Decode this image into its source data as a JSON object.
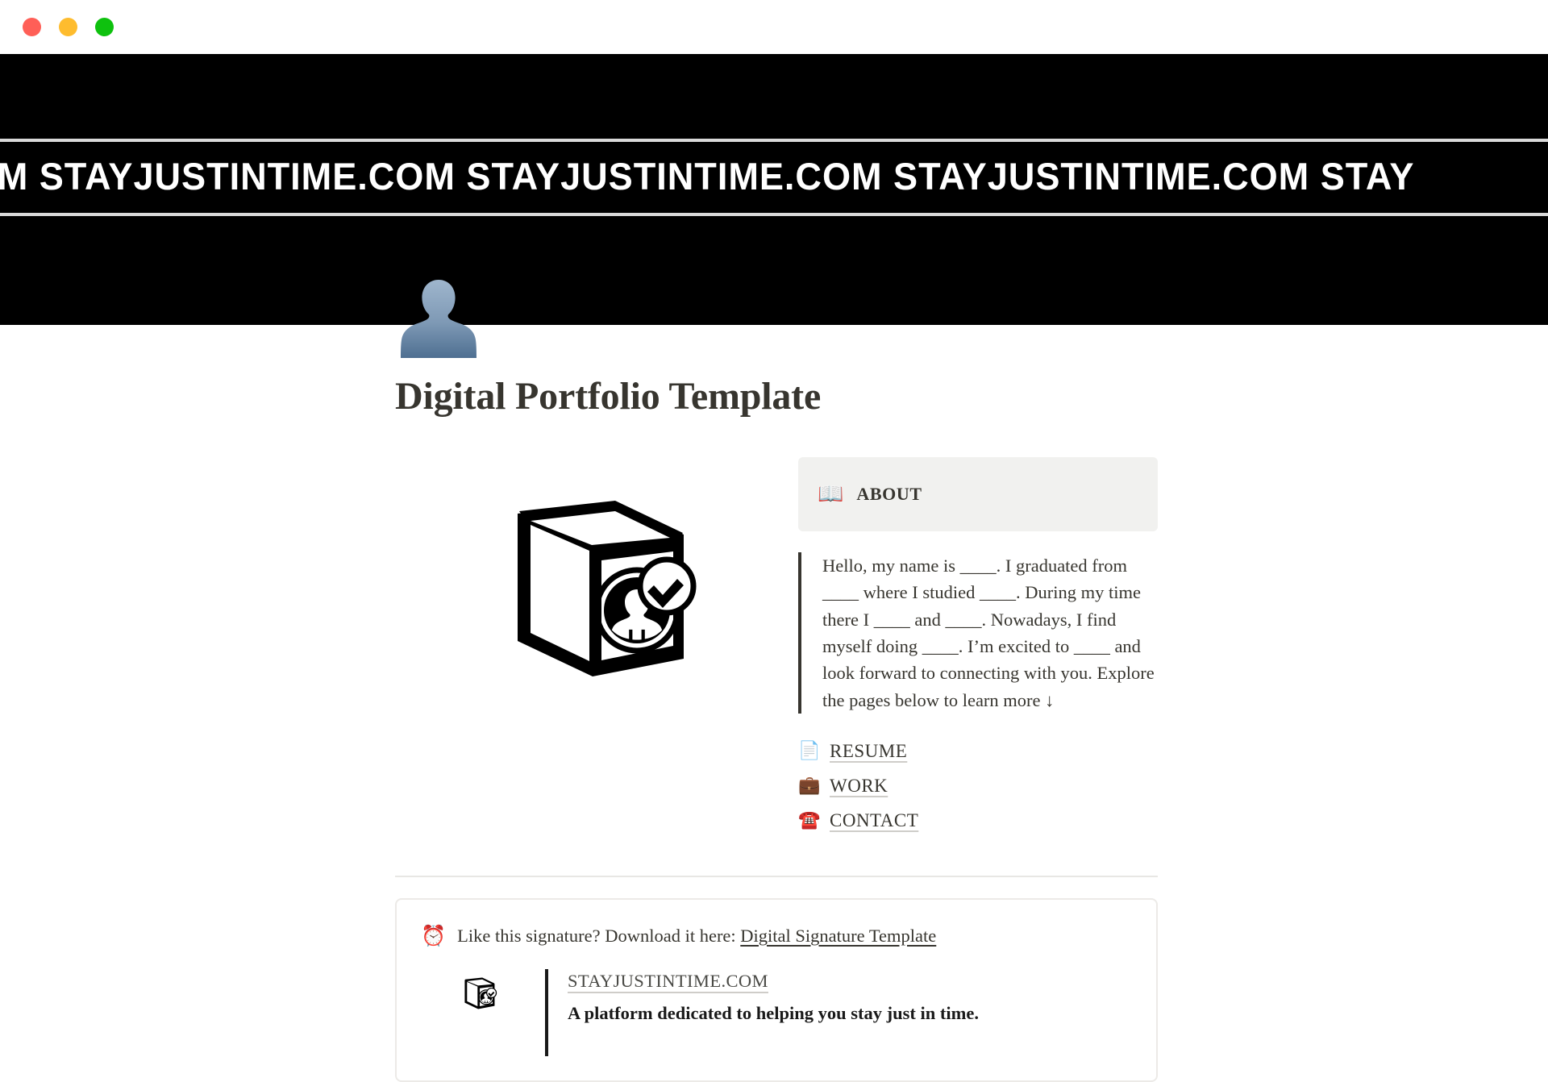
{
  "window": {
    "traffic_lights": [
      {
        "name": "close",
        "color": "#ff5f57"
      },
      {
        "name": "minimize",
        "color": "#febc2e"
      },
      {
        "name": "maximize",
        "color": "#0ec10e"
      }
    ]
  },
  "hero": {
    "marquee_text": "TIME.COM  STAYJUSTINTIME.COM  STAYJUSTINTIME.COM  STAYJUSTINTIME.COM  STAY",
    "background": "#000000",
    "rule_color": "#d9d9d9",
    "avatar_icon": "person-silhouette-avatar"
  },
  "page": {
    "title": "Digital Portfolio Template",
    "illustration_icon": "box-profile-check-logo"
  },
  "about": {
    "emoji": "📖",
    "emoji_name": "open-book-icon",
    "heading": "ABOUT",
    "body": "Hello, my name is ____. I graduated from ____ where I studied ____. During my time there I ____ and ____. Nowadays, I find myself doing ____. I’m excited to ____ and look forward to connecting with you. Explore the pages below to learn more ↓",
    "header_bg": "#f1f1ef"
  },
  "links": [
    {
      "emoji": "📄",
      "emoji_name": "page-facing-up-icon",
      "label": "RESUME"
    },
    {
      "emoji": "💼",
      "emoji_name": "briefcase-icon",
      "label": "WORK"
    },
    {
      "emoji": "☎️",
      "emoji_name": "telephone-icon",
      "label": "CONTACT"
    }
  ],
  "callout": {
    "emoji": "⏰",
    "emoji_name": "alarm-clock-icon",
    "prefix": "Like this signature? Download it here: ",
    "link_label": "Digital Signature Template",
    "signature": {
      "logo_name": "box-profile-check-logo-small",
      "domain": "STAYJUSTINTIME.COM",
      "tagline": "A platform dedicated to helping you stay just in time."
    }
  }
}
